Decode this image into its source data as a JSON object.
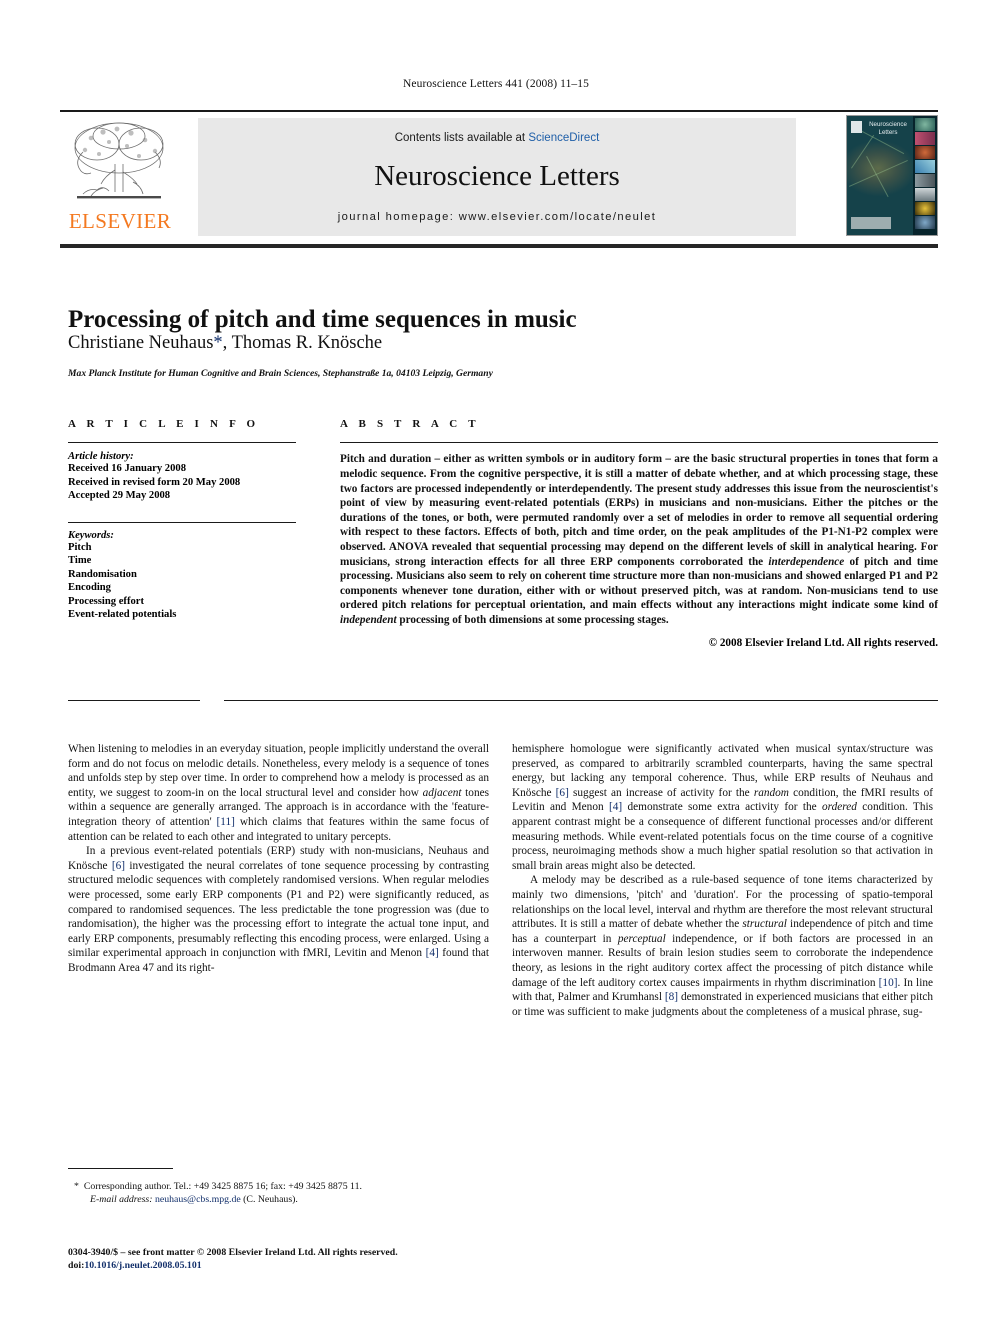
{
  "running_head": "Neuroscience Letters 441 (2008) 11–15",
  "masthead": {
    "contents_prefix": "Contents lists available at ",
    "sciencedirect": "ScienceDirect",
    "journal_title": "Neuroscience Letters",
    "homepage": "journal homepage: www.elsevier.com/locate/neulet",
    "publisher_logo_text": "ELSEVIER",
    "cover": {
      "journal_name": "Neuroscience Letters",
      "logo_alt": "elsevier-tree-logo"
    }
  },
  "article": {
    "title": "Processing of pitch and time sequences in music",
    "authors": "Christiane Neuhaus",
    "author_marker": "*",
    "authors_rest": ", Thomas R. Knösche",
    "affiliation": "Max Planck Institute for Human Cognitive and Brain Sciences, Stephanstraße 1a, 04103 Leipzig, Germany"
  },
  "article_info": {
    "heading": "A R T I C L E   I N F O",
    "history_label": "Article history:",
    "history": [
      "Received 16 January 2008",
      "Received in revised form 20 May 2008",
      "Accepted 29 May 2008"
    ],
    "keywords_label": "Keywords:",
    "keywords": [
      "Pitch",
      "Time",
      "Randomisation",
      "Encoding",
      "Processing effort",
      "Event-related potentials"
    ]
  },
  "abstract": {
    "heading": "A B S T R A C T",
    "paragraph_1": "Pitch and duration – either as written symbols or in auditory form – are the basic structural properties in tones that form a melodic sequence. From the cognitive perspective, it is still a matter of debate whether, and at which processing stage, these two factors are processed independently or interdependently. The present study addresses this issue from the neuroscientist's point of view by measuring event-related potentials (ERPs) in musicians and non-musicians. Either the pitches or the durations of the tones, or both, were permuted randomly over a set of melodies in order to remove all sequential ordering with respect to these factors. Effects of both, pitch and time order, on the peak amplitudes of the P1-N1-P2 complex were observed. ANOVA revealed that sequential processing may depend on the different levels of skill in analytical hearing. For musicians, strong interaction effects for all three ERP components corroborated the ",
    "italic_1": "interdependence",
    "paragraph_1b": " of pitch and time processing. Musicians also seem to rely on coherent time structure more than non-musicians and showed enlarged P1 and P2 components whenever tone duration, either with or without preserved pitch, was at random. Non-musicians tend to use ordered pitch relations for perceptual orientation, and main effects without any interactions might indicate some kind of ",
    "italic_2": "independent",
    "paragraph_1c": " processing of both dimensions at some processing stages.",
    "copyright": "© 2008 Elsevier Ireland Ltd. All rights reserved."
  },
  "body": {
    "left_p1_a": "When listening to melodies in an everyday situation, people implicitly understand the overall form and do not focus on melodic details. Nonetheless, every melody is a sequence of tones and unfolds step by step over time. In order to comprehend how a melody is processed as an entity, we suggest to zoom-in on the local structural level and consider how ",
    "left_p1_i1": "adjacent",
    "left_p1_b": " tones within a sequence are generally arranged. The approach is in accordance with the 'feature-integration theory of attention' ",
    "left_p1_ref1": "[11]",
    "left_p1_c": " which claims that features within the same focus of attention can be related to each other and integrated to unitary percepts.",
    "left_p2_a": "In a previous event-related potentials (ERP) study with non-musicians, Neuhaus and Knösche ",
    "left_p2_ref1": "[6]",
    "left_p2_b": " investigated the neural correlates of tone sequence processing by contrasting structured melodic sequences with completely randomised versions. When regular melodies were processed, some early ERP components (P1 and P2) were significantly reduced, as compared to randomised sequences. The less predictable the tone progression was (due to randomisation), the higher was the processing effort to integrate the actual tone input, and early ERP components, presumably reflecting this encoding process, were enlarged. Using a similar experimental approach in conjunction with fMRI, Levitin and Menon ",
    "left_p2_ref2": "[4]",
    "left_p2_c": " found that Brodmann Area 47 and its right-",
    "right_p1_a": "hemisphere homologue were significantly activated when musical syntax/structure was preserved, as compared to arbitrarily scrambled counterparts, having the same spectral energy, but lacking any temporal coherence. Thus, while ERP results of Neuhaus and Knösche ",
    "right_p1_ref1": "[6]",
    "right_p1_b": " suggest an increase of activity for the ",
    "right_p1_i1": "random",
    "right_p1_c": " condition, the fMRI results of Levitin and Menon ",
    "right_p1_ref2": "[4]",
    "right_p1_d": " demonstrate some extra activity for the ",
    "right_p1_i2": "ordered",
    "right_p1_e": " condition. This apparent contrast might be a consequence of different functional processes and/or different measuring methods. While event-related potentials focus on the time course of a cognitive process, neuroimaging methods show a much higher spatial resolution so that activation in small brain areas might also be detected.",
    "right_p2_a": "A melody may be described as a rule-based sequence of tone items characterized by mainly two dimensions, 'pitch' and 'duration'. For the processing of spatio-temporal relationships on the local level, interval and rhythm are therefore the most relevant structural attributes. It is still a matter of debate whether the ",
    "right_p2_i1": "structural",
    "right_p2_b": " independence of pitch and time has a counterpart in ",
    "right_p2_i2": "perceptual",
    "right_p2_c": " independence, or if both factors are processed in an interwoven manner. Results of brain lesion studies seem to corroborate the independence theory, as lesions in the right auditory cortex affect the processing of pitch distance while damage of the left auditory cortex causes impairments in rhythm discrimination ",
    "right_p2_ref1": "[10]",
    "right_p2_d": ". In line with that, Palmer and Krumhansl ",
    "right_p2_ref2": "[8]",
    "right_p2_e": " demonstrated in experienced musicians that either pitch or time was sufficient to make judgments about the completeness of a musical phrase, sug-"
  },
  "footnotes": {
    "corresponding_marker": "*",
    "corresponding": "Corresponding author. Tel.: +49 3425 8875 16; fax: +49 3425 8875 11.",
    "email_label": "E-mail address:",
    "email": "neuhaus@cbs.mpg.de",
    "email_suffix": "(C. Neuhaus).",
    "imprint": "0304-3940/$ – see front matter © 2008 Elsevier Ireland Ltd. All rights reserved.",
    "doi_label": "doi:",
    "doi": "10.1016/j.neulet.2008.05.101"
  },
  "colors": {
    "elsevier_orange": "#F47920",
    "link_blue": "#13306b",
    "sciencedirect_blue": "#1f5fa8",
    "banner_gray": "#e8e8e8"
  }
}
